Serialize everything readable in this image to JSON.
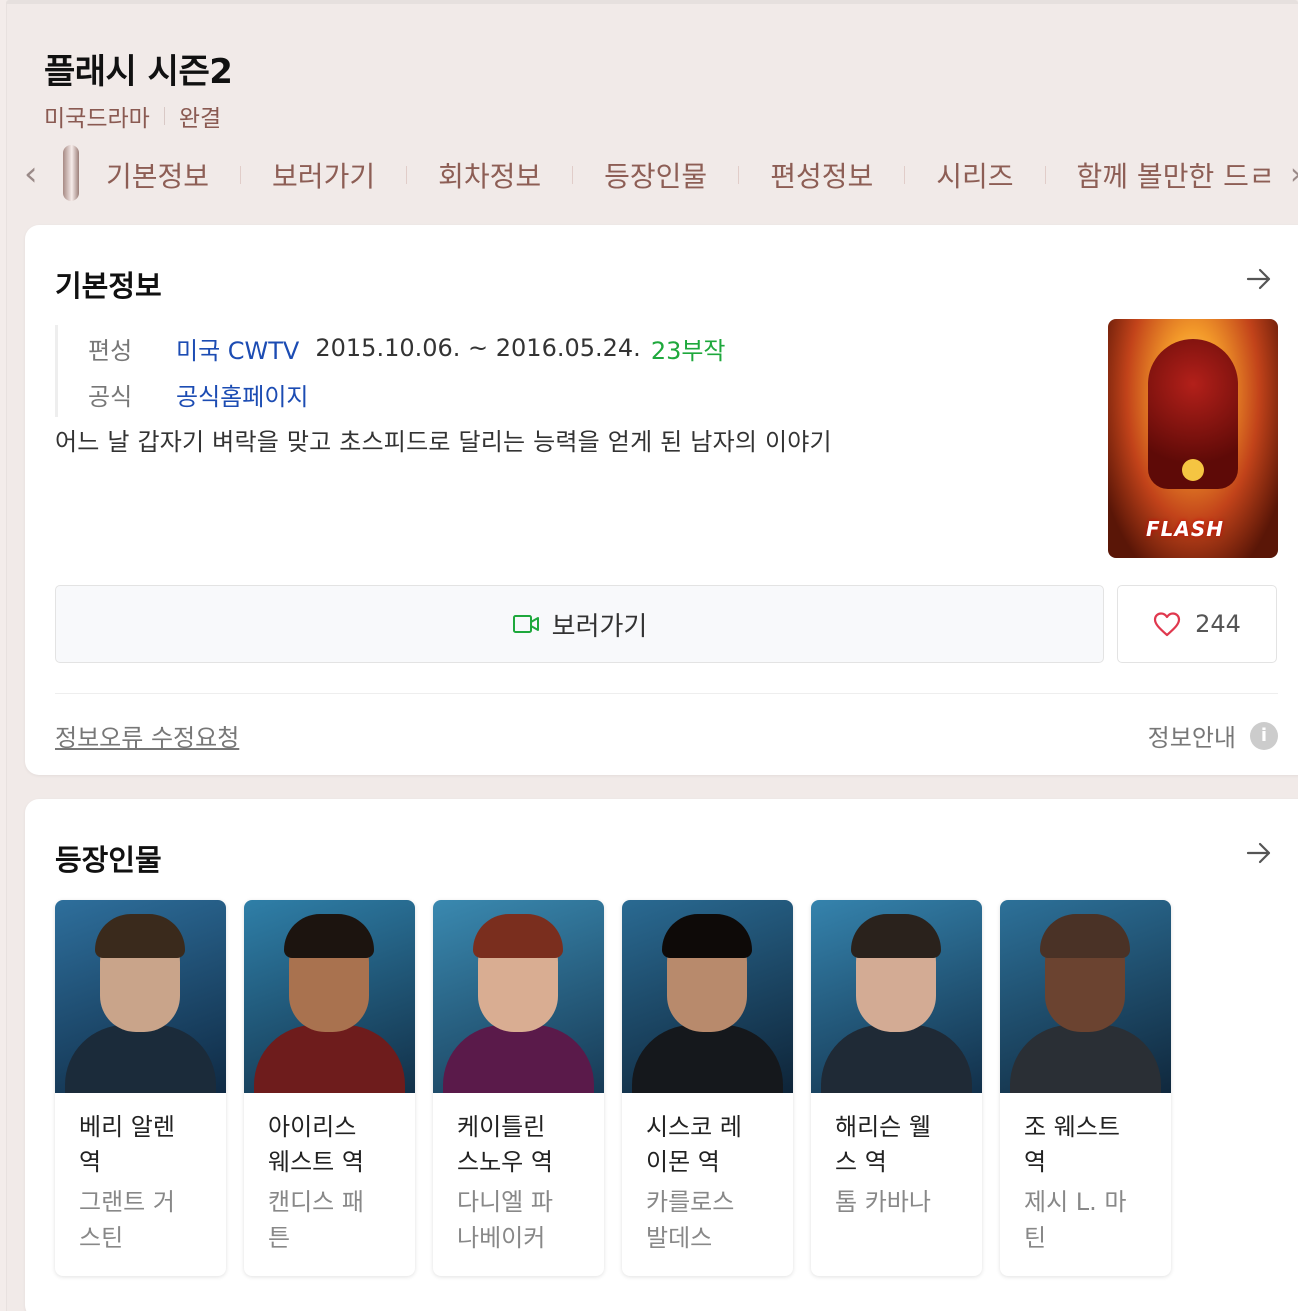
{
  "header": {
    "title": "플래시 시즌2",
    "genre": "미국드라마",
    "status": "완결"
  },
  "tabs": [
    "기본정보",
    "보러가기",
    "회차정보",
    "등장인물",
    "편성정보",
    "시리즈",
    "함께 볼만한 드ㄹ"
  ],
  "basic_info": {
    "section_title": "기본정보",
    "broadcast_label": "편성",
    "broadcast_channel": "미국 CWTV",
    "broadcast_period": "2015.10.06. ~ 2016.05.24.",
    "episodes": "23부작",
    "official_label": "공식",
    "official_link": "공식홈페이지",
    "description": "어느 날 갑자기 벼락을 맞고 초스피드로 달리는 능력을 얻게 된 남자의 이야기",
    "poster_title": "FLASH",
    "watch_label": "보러가기",
    "like_count": "244",
    "report_label": "정보오류 수정요청",
    "guide_label": "정보안내",
    "guide_icon_text": "i"
  },
  "cast": {
    "section_title": "등장인물",
    "members": [
      {
        "role_line1": "베리 알렌",
        "role_line2": "역",
        "actor_line1": "그랜트 거",
        "actor_line2": "스틴"
      },
      {
        "role_line1": "아이리스",
        "role_line2": "웨스트 역",
        "actor_line1": "캔디스 패",
        "actor_line2": "튼"
      },
      {
        "role_line1": "케이틀린",
        "role_line2": "스노우 역",
        "actor_line1": "다니엘 파",
        "actor_line2": "나베이커"
      },
      {
        "role_line1": "시스코 레",
        "role_line2": "이몬 역",
        "actor_line1": "카를로스",
        "actor_line2": "발데스"
      },
      {
        "role_line1": "해리슨 웰",
        "role_line2": "스 역",
        "actor_line1": "톰 카바나",
        "actor_line2": ""
      },
      {
        "role_line1": "조 웨스트",
        "role_line2": "역",
        "actor_line1": "제시 L. 마",
        "actor_line2": "틴"
      }
    ]
  },
  "colors": {
    "accent_brown": "#8d5e55",
    "link_blue": "#1c4cb3",
    "episode_green": "#1ea83c",
    "heart_red": "#e0384e"
  },
  "icons": [
    "chevron-left-icon",
    "chevron-right-icon",
    "arrow-right-icon",
    "video-icon",
    "heart-icon",
    "info-icon"
  ]
}
